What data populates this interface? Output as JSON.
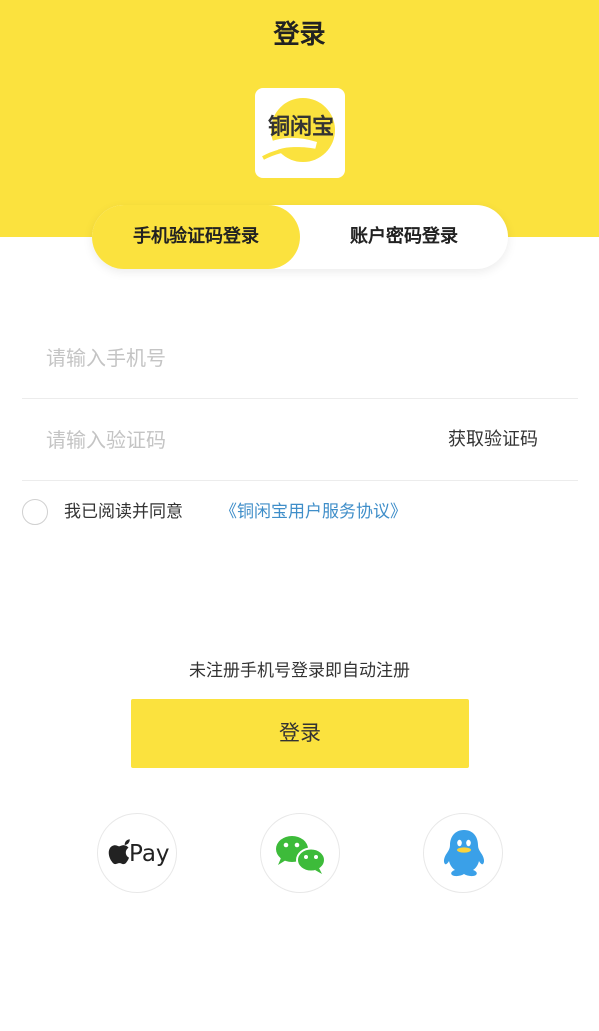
{
  "header": {
    "title": "登录",
    "background_color": "#fbe23e",
    "logo": {
      "icon": "tongxianbao-logo",
      "text": "铜闲宝"
    }
  },
  "tabs": [
    {
      "label": "手机验证码登录",
      "active": true
    },
    {
      "label": "账户密码登录",
      "active": false
    }
  ],
  "form": {
    "phone_placeholder": "请输入手机号",
    "phone_value": "",
    "code_placeholder": "请输入验证码",
    "code_value": "",
    "get_code_label": "获取验证码"
  },
  "agreement": {
    "checked": false,
    "text": "我已阅读并同意",
    "link": "《铜闲宝用户服务协议》",
    "link_color": "#3f8ec9"
  },
  "register_hint": "未注册手机号登录即自动注册",
  "login_button": "登录",
  "social_logins": [
    {
      "name": "apple-pay",
      "icon": "apple-icon",
      "label": "Pay"
    },
    {
      "name": "wechat",
      "icon": "wechat-icon",
      "color": "#3dbb3a"
    },
    {
      "name": "qq",
      "icon": "qq-icon",
      "color": "#3aa0e8"
    }
  ]
}
